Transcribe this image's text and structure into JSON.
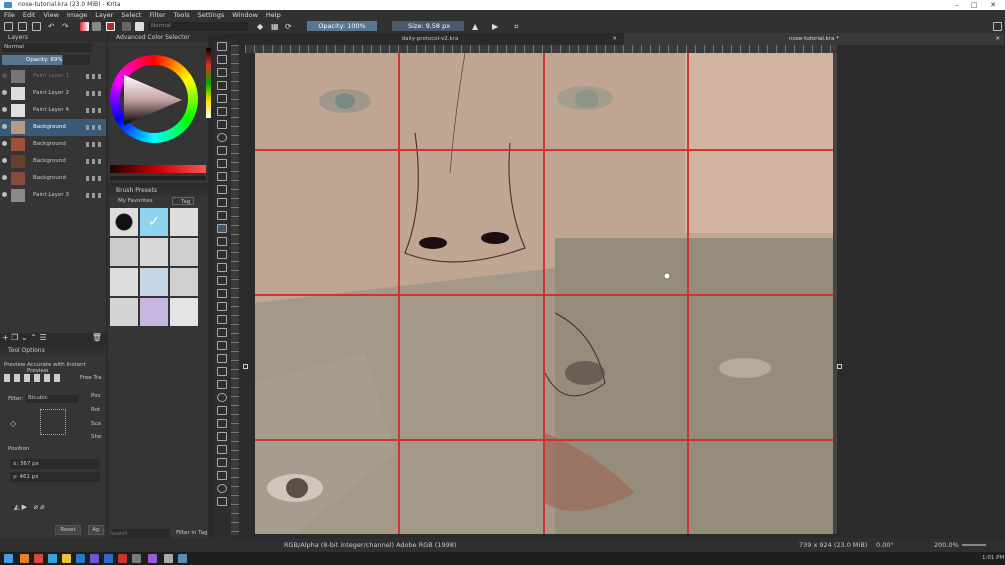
{
  "window": {
    "title": "nose-tutorial.kra (23.0 MiB) - Krita",
    "min": "–",
    "max": "□",
    "close": "✕"
  },
  "menu": [
    "File",
    "Edit",
    "View",
    "Image",
    "Layer",
    "Select",
    "Filter",
    "Tools",
    "Settings",
    "Window",
    "Help"
  ],
  "toolbar": {
    "blend_mode": "Normal",
    "opacity": "Opacity: 100%",
    "size": "Size: 9.58 px"
  },
  "layers_panel": {
    "title": "Layers",
    "blend": "Normal",
    "opacity": "Opacity:  69%",
    "items": [
      {
        "name": "Paint Layer 1",
        "dim": true
      },
      {
        "name": "Paint Layer 2",
        "dim": false
      },
      {
        "name": "Paint Layer 4",
        "dim": false
      },
      {
        "name": "Background",
        "dim": false,
        "selected": true
      },
      {
        "name": "Background",
        "dim": false
      },
      {
        "name": "Background",
        "dim": false
      },
      {
        "name": "Background",
        "dim": false
      },
      {
        "name": "Paint Layer 3",
        "dim": false
      }
    ]
  },
  "tool_options": {
    "title": "Tool Options",
    "preview": "Preview",
    "preview_mode": "Accurate with Instant Preview",
    "free_transform": "Free Tra",
    "filter_label": "Filter:",
    "filter_value": "Bicubic",
    "pos": "Pos",
    "rot": "Rot",
    "sca": "Sca",
    "she": "She",
    "position_label": "Position",
    "x_value": "x: 367 px",
    "y_value": "y: 461 px",
    "reset": "Reset",
    "apply": "Ap"
  },
  "color_selector": {
    "title": "Advanced Color Selector"
  },
  "brush_presets": {
    "title": "Brush Presets",
    "filter": "My Favorites",
    "tag": "Tag",
    "search_placeholder": "Search",
    "filter_in_tag": "Filter in Tag"
  },
  "tabs": [
    {
      "label": "daily-protocol-v2.kra"
    },
    {
      "label": "nose-tutorial.kra *"
    }
  ],
  "status": {
    "color_space": "RGB/Alpha (8-bit integer/channel)  Adobe RGB (1998)",
    "dims": "739 x 924 (23.0 MiB)",
    "rotation": "0.00°",
    "zoom": "200.0%"
  },
  "taskbar": {
    "time": "1:01 PM"
  },
  "colors": {
    "accent": "#5a7590",
    "selection": "#3a5a78",
    "grid": "#d42a2a",
    "skin": "#c9a996"
  }
}
